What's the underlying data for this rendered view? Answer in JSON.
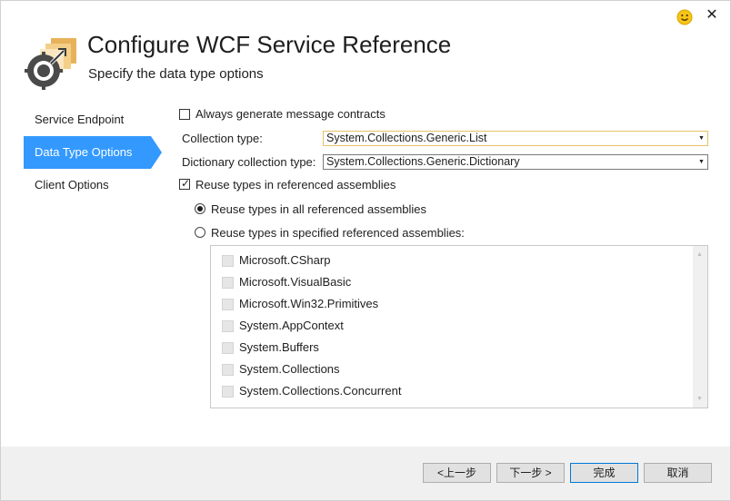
{
  "window": {
    "title": "Configure WCF Service Reference",
    "subtitle": "Specify the data type options"
  },
  "nav": {
    "items": [
      {
        "label": "Service Endpoint",
        "selected": false
      },
      {
        "label": "Data Type Options",
        "selected": true
      },
      {
        "label": "Client Options",
        "selected": false
      }
    ],
    "accent": "#3399ff"
  },
  "options": {
    "always_generate_label": "Always generate message contracts",
    "always_generate_checked": false,
    "collection_type_label": "Collection type:",
    "collection_type_value": "System.Collections.Generic.List",
    "dictionary_type_label": "Dictionary collection type:",
    "dictionary_type_value": "System.Collections.Generic.Dictionary",
    "reuse_types_label": "Reuse types in referenced assemblies",
    "reuse_types_checked": true,
    "reuse_all_label": "Reuse types in all referenced assemblies",
    "reuse_all_selected": true,
    "reuse_specified_label": "Reuse types in specified referenced assemblies:",
    "reuse_specified_selected": false
  },
  "assemblies": [
    "Microsoft.CSharp",
    "Microsoft.VisualBasic",
    "Microsoft.Win32.Primitives",
    "System.AppContext",
    "System.Buffers",
    "System.Collections",
    "System.Collections.Concurrent"
  ],
  "footer": {
    "prev_label": "<上一步",
    "next_label": "下一步 >",
    "finish_label": "完成",
    "cancel_label": "取消"
  },
  "icons": {
    "title": "wcf-service-reference-icon",
    "feedback": "smiley-feedback-icon",
    "close": "close-icon"
  }
}
